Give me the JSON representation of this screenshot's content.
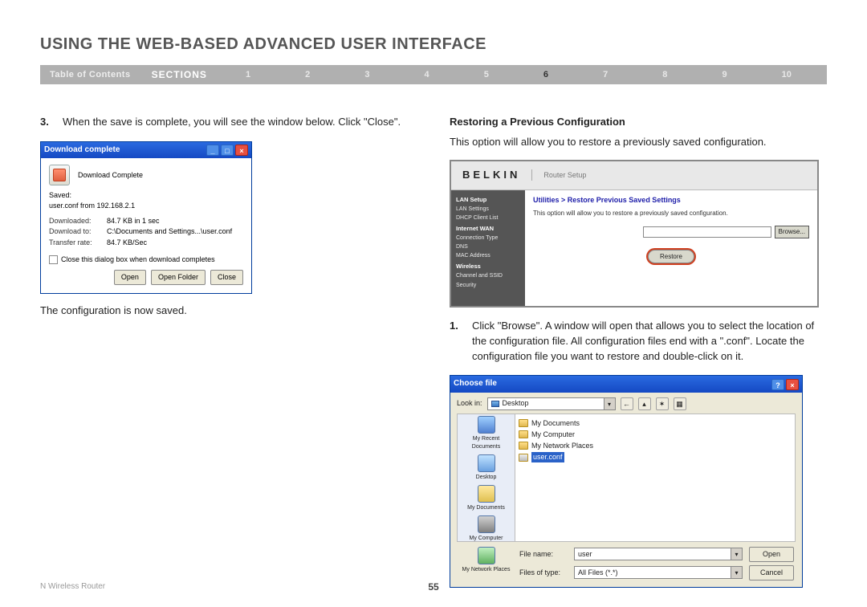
{
  "page": {
    "title": "USING THE WEB-BASED ADVANCED USER INTERFACE",
    "footer_left": "N Wireless Router",
    "page_number": "55"
  },
  "nav": {
    "toc": "Table of Contents",
    "sections": "SECTIONS",
    "numbers": [
      "1",
      "2",
      "3",
      "4",
      "5",
      "6",
      "7",
      "8",
      "9",
      "10"
    ],
    "active_index": 5
  },
  "left": {
    "step_num": "3.",
    "step_text": "When the save is complete, you will see the window below. Click \"Close\".",
    "after_dialog": "The configuration is now saved."
  },
  "dlg": {
    "title": "Download complete",
    "heading": "Download Complete",
    "saved_label": "Saved:",
    "saved_value": "user.conf from 192.168.2.1",
    "rows": {
      "downloaded_label": "Downloaded:",
      "downloaded_value": "84.7 KB in 1 sec",
      "to_label": "Download to:",
      "to_value": "C:\\Documents and Settings...\\user.conf",
      "rate_label": "Transfer rate:",
      "rate_value": "84.7 KB/Sec"
    },
    "checkbox": "Close this dialog box when download completes",
    "btn_open": "Open",
    "btn_open_folder": "Open Folder",
    "btn_close": "Close"
  },
  "right": {
    "subhead": "Restoring a Previous Configuration",
    "intro": "This option will allow you to restore a previously saved configuration.",
    "step_num": "1.",
    "step_text": "Click \"Browse\". A window will open that allows you to select the location of the configuration file. All configuration files end with a \".conf\". Locate the configuration file you want to restore and double-click on it."
  },
  "router": {
    "brand": "BELKIN",
    "head_sub": "Router Setup",
    "nav": {
      "g1": "LAN Setup",
      "g1a": "LAN Settings",
      "g1b": "DHCP Client List",
      "g2": "Internet WAN",
      "g2a": "Connection Type",
      "g2b": "DNS",
      "g2c": "MAC Address",
      "g3": "Wireless",
      "g3a": "Channel and SSID",
      "g3b": "Security"
    },
    "crumb": "Utilities > Restore Previous Saved Settings",
    "desc": "This option will allow you to restore a previously saved configuration.",
    "browse": "Browse...",
    "restore": "Restore"
  },
  "choose": {
    "title": "Choose file",
    "lookin_label": "Look in:",
    "lookin_value": "Desktop",
    "side": {
      "recent": "My Recent Documents",
      "desktop": "Desktop",
      "mydocs": "My Documents",
      "mycomp": "My Computer",
      "mynet": "My Network Places"
    },
    "files": {
      "f1": "My Documents",
      "f2": "My Computer",
      "f3": "My Network Places",
      "f4": "user.conf"
    },
    "filename_label": "File name:",
    "filename_value": "user",
    "filetype_label": "Files of type:",
    "filetype_value": "All Files (*.*)",
    "btn_open": "Open",
    "btn_cancel": "Cancel"
  }
}
